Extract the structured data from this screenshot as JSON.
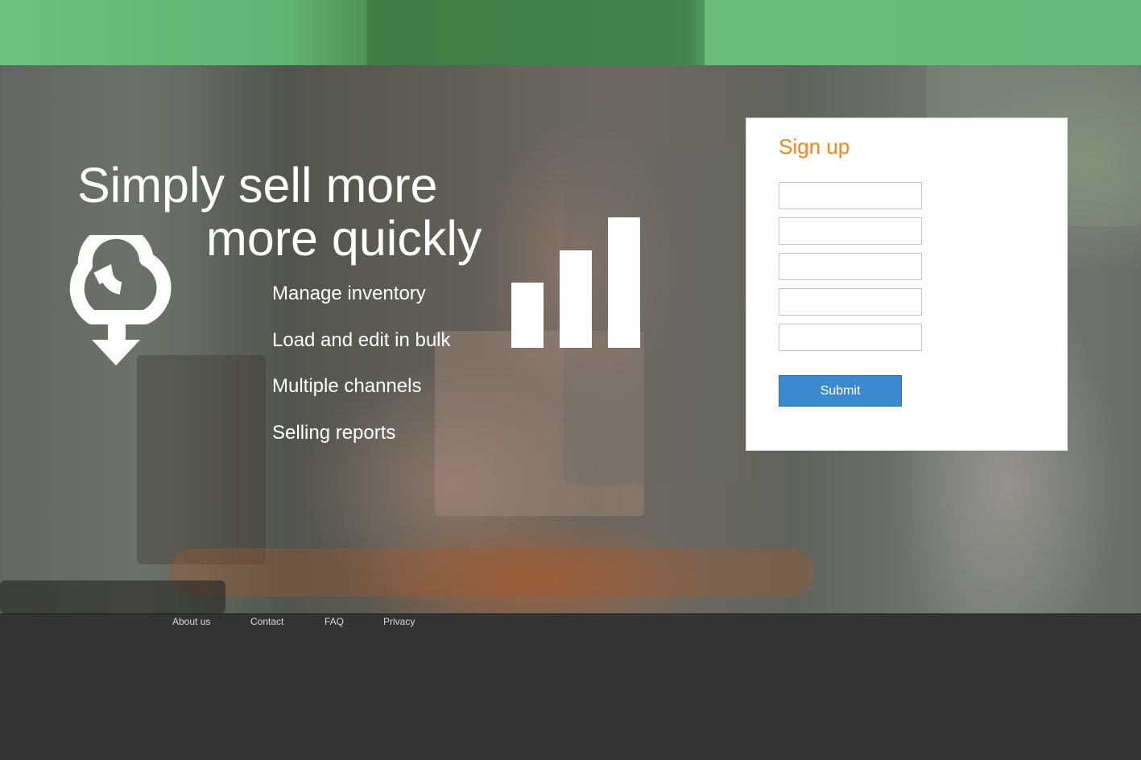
{
  "hero": {
    "headline_line1": "Simply sell more",
    "headline_line2": "more quickly",
    "features": [
      "Manage inventory",
      "Load and edit in bulk",
      "Multiple channels",
      "Selling reports"
    ],
    "icons": [
      "cloud-download-icon",
      "bar-chart-icon"
    ]
  },
  "signup": {
    "title": "Sign up",
    "fields": [
      {
        "value": "",
        "placeholder": ""
      },
      {
        "value": "",
        "placeholder": ""
      },
      {
        "value": "",
        "placeholder": ""
      },
      {
        "value": "",
        "placeholder": ""
      },
      {
        "value": "",
        "placeholder": ""
      }
    ],
    "submit_label": "Submit"
  },
  "footer": {
    "links": [
      "About us",
      "Contact",
      "FAQ",
      "Privacy"
    ]
  },
  "colors": {
    "header_green": "#63b474",
    "title_orange": "#f0861d",
    "button_blue": "#3d89d0",
    "footer_dark": "#333333"
  }
}
